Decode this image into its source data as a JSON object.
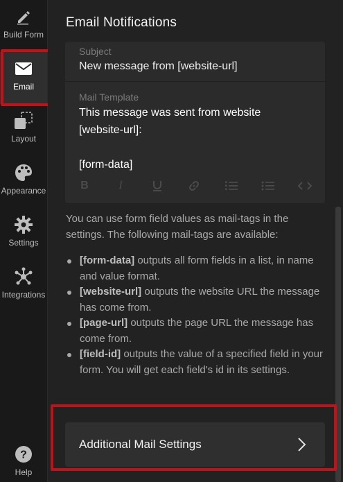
{
  "sidebar": {
    "items": [
      {
        "label": "Build Form",
        "icon": "pencil-icon"
      },
      {
        "label": "Email",
        "icon": "envelope-icon"
      },
      {
        "label": "Layout",
        "icon": "layout-icon"
      },
      {
        "label": "Appearance",
        "icon": "palette-icon"
      },
      {
        "label": "Settings",
        "icon": "gear-icon"
      },
      {
        "label": "Integrations",
        "icon": "integrations-icon"
      },
      {
        "label": "Help",
        "icon": "help-icon"
      }
    ],
    "active": "Email"
  },
  "main": {
    "title": "Email Notifications",
    "subject": {
      "label": "Subject",
      "value": "New message from [website-url]"
    },
    "template": {
      "label": "Mail Template",
      "lines": [
        "This message was sent from website",
        "[website-url]:",
        "",
        "[form-data]"
      ],
      "toolbar": [
        "bold-icon",
        "italic-icon",
        "underline-icon",
        "link-icon",
        "ordered-list-icon",
        "bullet-list-icon",
        "code-icon"
      ]
    },
    "help_text": "You can use form field values as mail-tags in the settings. The following mail-tags are available:",
    "mail_tags": [
      {
        "tag": "[form-data]",
        "description": " outputs all form fields in a list, in name and value format."
      },
      {
        "tag": "[website-url]",
        "description": " outputs the website URL the message has come from."
      },
      {
        "tag": "[page-url]",
        "description": " outputs the page URL the message has come from."
      },
      {
        "tag": "[field-id]",
        "description": " outputs the value of a specified field in your form. You will get each field's id in its settings."
      }
    ],
    "additional_settings_label": "Additional Mail Settings"
  },
  "colors": {
    "highlight": "#c1121a",
    "background": "#222222",
    "sidebar": "#191919"
  }
}
